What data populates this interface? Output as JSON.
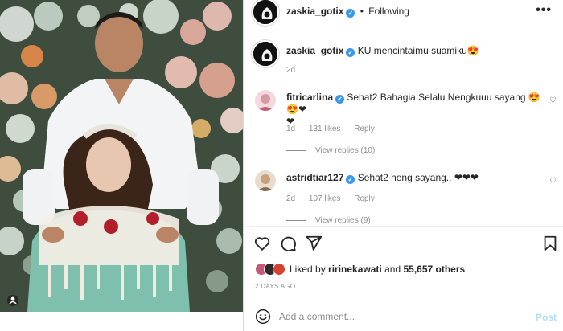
{
  "post": {
    "author": "zaskia_gotix",
    "follow_state": "Following",
    "separator": "•",
    "more": "•••",
    "caption": "KU mencintaimu suamiku😍",
    "caption_time": "2d"
  },
  "comments": [
    {
      "username": "fitricarlina",
      "text": "Sehat2 Bahagia Selalu Nengkuuu sayang 😍😍❤",
      "text2": "❤",
      "time": "1d",
      "likes": "131 likes",
      "reply": "Reply",
      "view_replies": "View replies (10)"
    },
    {
      "username": "astridtiar127",
      "text": "Sehat2 neng sayang.. ❤❤❤",
      "time": "2d",
      "likes": "107 likes",
      "reply": "Reply",
      "view_replies": "View replies (9)"
    }
  ],
  "likes": {
    "liked_by_prefix": "Liked by",
    "liked_by_user": "ririnekawati",
    "and": "and",
    "count": "55,657 others"
  },
  "post_date": "2 DAYS AGO",
  "composer": {
    "placeholder": "Add a comment...",
    "post_label": "Post"
  },
  "icons": {
    "verified": "✓",
    "heart_small": "♡"
  },
  "colors": {
    "verified_blue": "#3897f0",
    "post_button_disabled": "#b2dffc",
    "meta_grey": "#8e8e8e"
  }
}
